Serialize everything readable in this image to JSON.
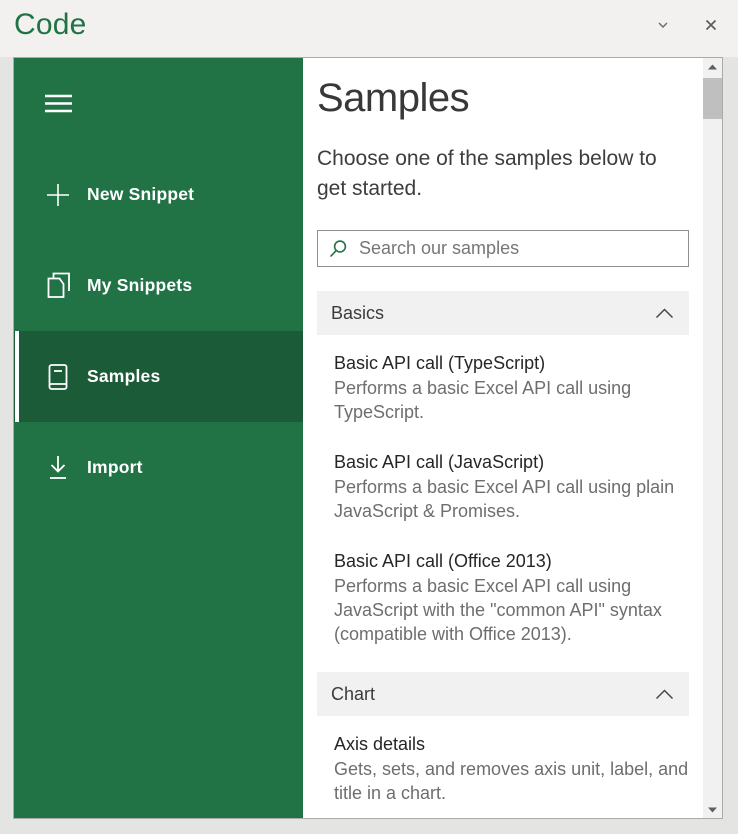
{
  "window": {
    "title": "Code",
    "controls": {
      "dropdown_icon": "chevron-down-icon",
      "close_icon": "close-icon"
    }
  },
  "colors": {
    "accent_green": "#217346",
    "selected_green": "#1b5b37",
    "section_header_bg": "#f1f1f1",
    "title_green": "#217346"
  },
  "sidebar": {
    "menu_icon": "hamburger-menu-icon",
    "items": [
      {
        "label": "New Snippet",
        "icon": "plus-icon",
        "selected": false
      },
      {
        "label": "My Snippets",
        "icon": "snippets-icon",
        "selected": false
      },
      {
        "label": "Samples",
        "icon": "book-icon",
        "selected": true
      },
      {
        "label": "Import",
        "icon": "download-icon",
        "selected": false
      }
    ]
  },
  "main": {
    "heading": "Samples",
    "intro": "Choose one of the samples below to get started.",
    "search": {
      "placeholder": "Search our samples",
      "icon": "search-icon"
    },
    "sections": [
      {
        "title": "Basics",
        "state_icon": "chevron-up-icon",
        "items": [
          {
            "title": "Basic API call (TypeScript)",
            "description": "Performs a basic Excel API call using TypeScript."
          },
          {
            "title": "Basic API call (JavaScript)",
            "description": "Performs a basic Excel API call using plain JavaScript & Promises."
          },
          {
            "title": "Basic API call (Office 2013)",
            "description": "Performs a basic Excel API call using JavaScript with the \"common API\" syntax (compatible with Office 2013)."
          }
        ]
      },
      {
        "title": "Chart",
        "state_icon": "chevron-up-icon",
        "items": [
          {
            "title": "Axis details",
            "description": "Gets, sets, and removes axis unit, label, and title in a chart."
          }
        ]
      }
    ]
  },
  "scrollbar": {
    "up_icon": "scroll-up-icon",
    "down_icon": "scroll-down-icon"
  }
}
